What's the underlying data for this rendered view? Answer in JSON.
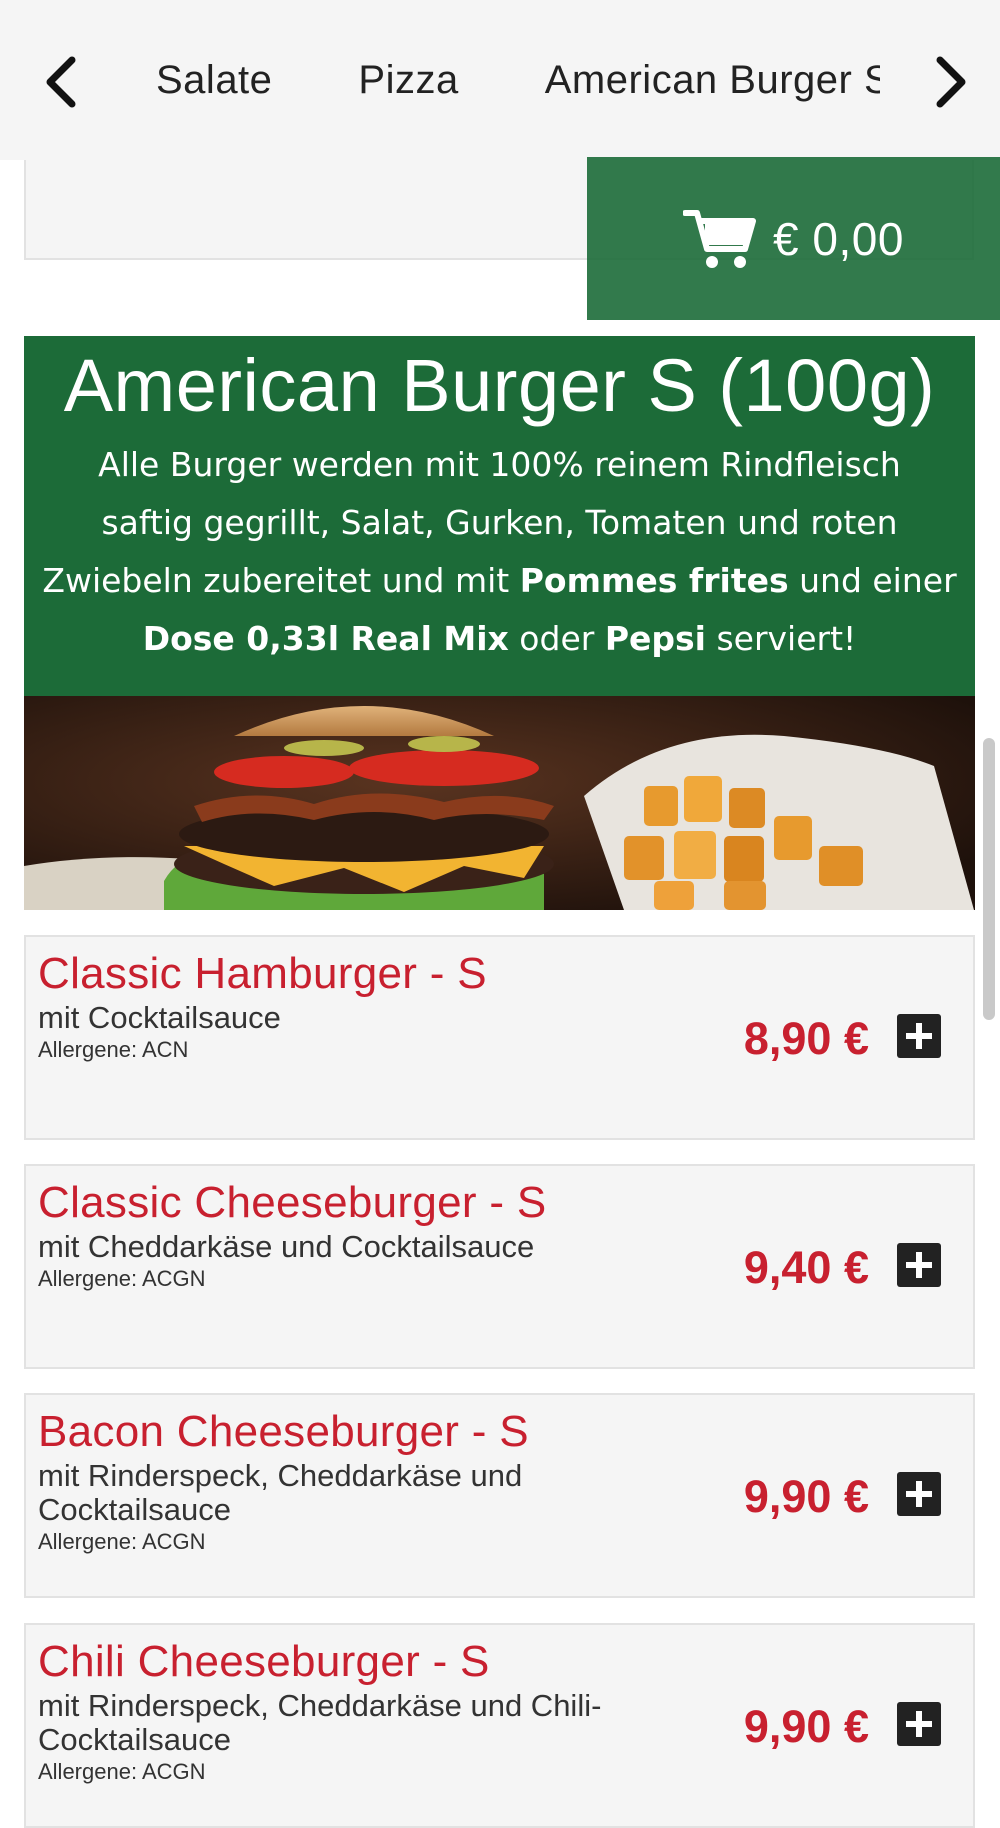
{
  "category_nav": {
    "tabs": [
      "Salate",
      "Pizza",
      "American Burger S"
    ]
  },
  "cart": {
    "amount": "€ 0,00",
    "icon": "shopping-cart-icon"
  },
  "section": {
    "title": "American Burger S (100g)",
    "description_lines": [
      [
        "Alle Burger werden mit 100% reinem Rindfleisch",
        "",
        "",
        "",
        "",
        ""
      ],
      [
        "saftig gegrillt, Salat, Gurken, Tomaten und roten",
        "",
        "",
        "",
        "",
        ""
      ],
      [
        "Zwiebeln zubereitet und mit ",
        "Pommes frites",
        " und einer",
        "",
        "",
        ""
      ],
      [
        "",
        "Dose 0,33l Real Mix",
        " oder ",
        "Pepsi",
        " serviert!",
        ""
      ]
    ]
  },
  "products": [
    {
      "name": "Classic Hamburger - S",
      "description": "mit Cocktailsauce",
      "allergens": "Allergene: ACN",
      "price": "8,90 €"
    },
    {
      "name": "Classic Cheeseburger - S",
      "description": "mit Cheddarkäse und Cocktailsauce",
      "allergens": "Allergene: ACGN",
      "price": "9,40 €"
    },
    {
      "name": "Bacon Cheeseburger - S",
      "description": "mit Rinderspeck, Cheddarkäse und Cocktailsauce",
      "allergens": "Allergene: ACGN",
      "price": "9,90 €"
    },
    {
      "name": "Chili Cheeseburger - S",
      "description": "mit Rinderspeck, Cheddarkäse und Chili-Cocktailsauce",
      "allergens": "Allergene: ACGN",
      "price": "9,90 €"
    }
  ],
  "colors": {
    "brand_green": "#1c6b38",
    "price_red": "#c8202f"
  }
}
